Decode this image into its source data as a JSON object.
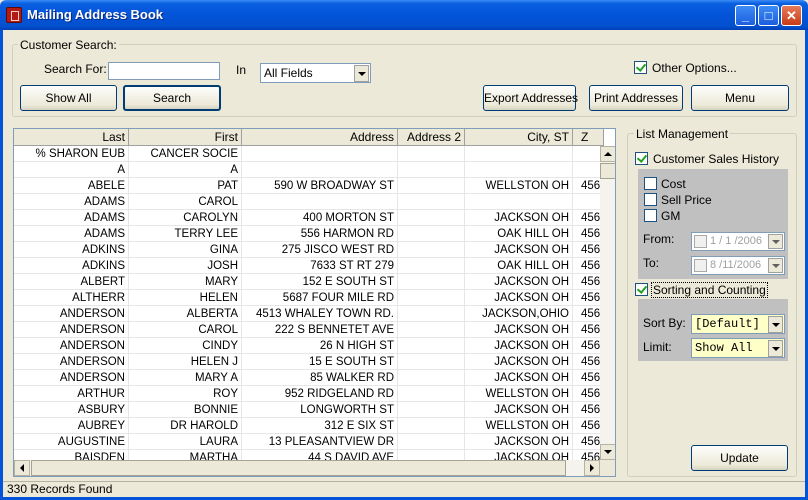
{
  "window": {
    "title": "Mailing Address Book"
  },
  "search": {
    "group_label": "Customer Search:",
    "search_for_label": "Search For:",
    "search_value": "",
    "in_label": "In",
    "field_selected": "All Fields",
    "show_all_label": "Show All",
    "search_label": "Search",
    "other_options_label": "Other Options..."
  },
  "toolbar": {
    "export_label": "Export Addresses",
    "print_label": "Print Addresses",
    "menu_label": "Menu"
  },
  "grid": {
    "columns": [
      "Last",
      "First",
      "Address",
      "Address 2",
      "City, ST",
      "Z"
    ],
    "rows": [
      [
        "% SHARON EUB",
        "CANCER SOCIE",
        "",
        "",
        "",
        ""
      ],
      [
        "A",
        "A",
        "",
        "",
        "",
        ""
      ],
      [
        "ABELE",
        "PAT",
        "590 W BROADWAY ST",
        "",
        "WELLSTON OH",
        "456"
      ],
      [
        "ADAMS",
        "CAROL",
        "",
        "",
        "",
        ""
      ],
      [
        "ADAMS",
        "CAROLYN",
        "400 MORTON ST",
        "",
        "JACKSON OH",
        "456"
      ],
      [
        "ADAMS",
        "TERRY LEE",
        "556 HARMON RD",
        "",
        "OAK HILL OH",
        "456"
      ],
      [
        "ADKINS",
        "GINA",
        "275 JISCO WEST RD",
        "",
        "JACKSON OH",
        "456"
      ],
      [
        "ADKINS",
        "JOSH",
        "7633 ST RT 279",
        "",
        "OAK HILL OH",
        "456"
      ],
      [
        "ALBERT",
        "MARY",
        "152 E SOUTH ST",
        "",
        "JACKSON OH",
        "456"
      ],
      [
        "ALTHERR",
        "HELEN",
        "5687 FOUR MILE RD",
        "",
        "JACKSON OH",
        "456"
      ],
      [
        "ANDERSON",
        "ALBERTA",
        "4513 WHALEY TOWN RD.",
        "",
        "JACKSON,OHIO",
        "456"
      ],
      [
        "ANDERSON",
        "CAROL",
        "222 S BENNETET AVE",
        "",
        "JACKSON OH",
        "456"
      ],
      [
        "ANDERSON",
        "CINDY",
        "26 N HIGH ST",
        "",
        "JACKSON OH",
        "456"
      ],
      [
        "ANDERSON",
        "HELEN J",
        "15 E SOUTH ST",
        "",
        "JACKSON OH",
        "456"
      ],
      [
        "ANDERSON",
        "MARY A",
        "85 WALKER RD",
        "",
        "JACKSON OH",
        "456"
      ],
      [
        "ARTHUR",
        "ROY",
        "952 RIDGELAND RD",
        "",
        "WELLSTON OH",
        "456"
      ],
      [
        "ASBURY",
        "BONNIE",
        "LONGWORTH ST",
        "",
        "JACKSON OH",
        "456"
      ],
      [
        "AUBREY",
        "DR HAROLD",
        "312 E SIX ST",
        "",
        "WELLSTON OH",
        "456"
      ],
      [
        "AUGUSTINE",
        "LAURA",
        "13 PLEASANTVIEW DR",
        "",
        "JACKSON OH",
        "456"
      ],
      [
        "BAISDEN",
        "MARTHA",
        "44 S DAVID AVE",
        "",
        "JACKSON OH",
        "456"
      ]
    ]
  },
  "list_management": {
    "group_label": "List Management",
    "sales_history_label": "Customer Sales History",
    "cost_label": "Cost",
    "sell_price_label": "Sell Price",
    "gm_label": "GM",
    "from_label": "From:",
    "from_value": "1 / 1 /2006",
    "to_label": "To:",
    "to_value": "8 /11/2006",
    "sorting_label": "Sorting and Counting",
    "sort_by_label": "Sort By:",
    "sort_by_value": "[Default]",
    "limit_label": "Limit:",
    "limit_value": "Show All",
    "update_label": "Update"
  },
  "status": {
    "text": "330 Records Found"
  }
}
